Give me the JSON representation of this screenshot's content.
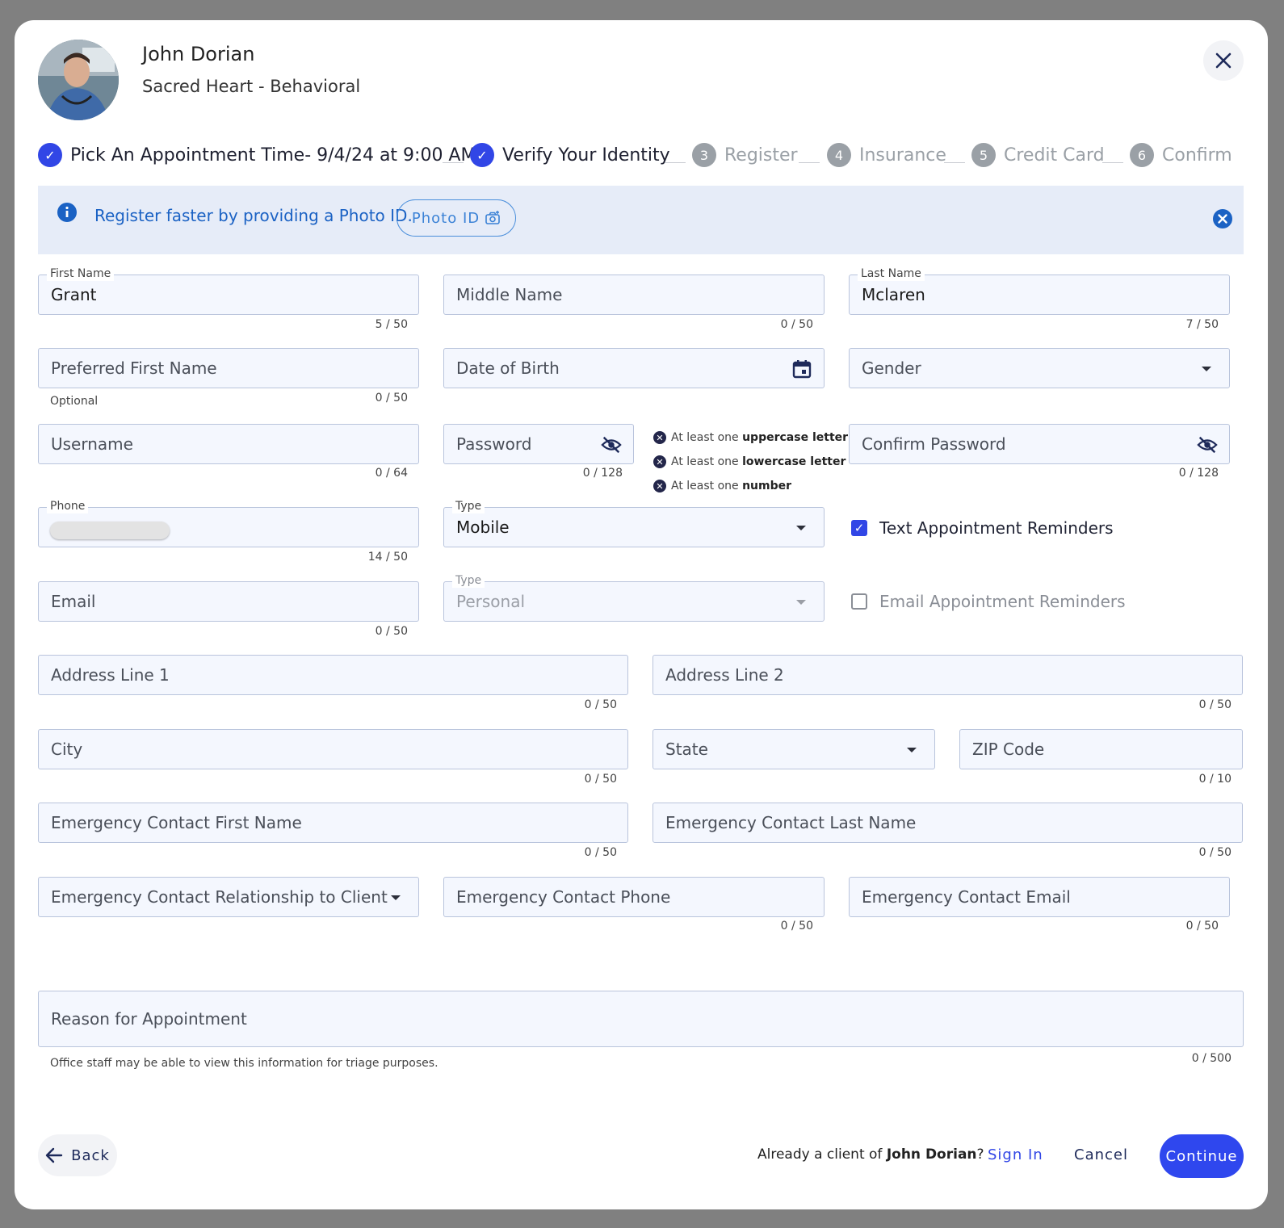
{
  "provider": {
    "name": "John Dorian",
    "organization": "Sacred Heart - Behavioral"
  },
  "stepper": [
    {
      "label": "Pick An Appointment Time- 9/4/24 at 9:00 AM",
      "state": "done",
      "num": ""
    },
    {
      "label": "Verify Your Identity",
      "state": "done",
      "num": ""
    },
    {
      "label": "Register",
      "state": "todo",
      "num": "3"
    },
    {
      "label": "Insurance",
      "state": "todo",
      "num": "4"
    },
    {
      "label": "Credit Card",
      "state": "todo",
      "num": "5"
    },
    {
      "label": "Confirm",
      "state": "todo",
      "num": "6"
    }
  ],
  "banner": {
    "text": "Register faster by providing a Photo ID.",
    "button": "Photo ID"
  },
  "fields": {
    "first_name": {
      "label": "First Name",
      "value": "Grant",
      "counter": "5 / 50"
    },
    "middle_name": {
      "placeholder": "Middle Name",
      "counter": "0 / 50"
    },
    "last_name": {
      "label": "Last Name",
      "value": "Mclaren",
      "counter": "7 / 50"
    },
    "preferred_first_name": {
      "placeholder": "Preferred First Name",
      "hint": "Optional",
      "counter": "0 / 50"
    },
    "date_of_birth": {
      "placeholder": "Date of Birth"
    },
    "gender": {
      "placeholder": "Gender"
    },
    "username": {
      "placeholder": "Username",
      "counter": "0 / 64"
    },
    "password": {
      "placeholder": "Password",
      "counter": "0 / 128"
    },
    "confirm_password": {
      "placeholder": "Confirm Password",
      "counter": "0 / 128"
    },
    "phone": {
      "label": "Phone",
      "counter": "14 / 50"
    },
    "phone_type": {
      "label": "Type",
      "value": "Mobile"
    },
    "email": {
      "placeholder": "Email",
      "counter": "0 / 50"
    },
    "email_type": {
      "label": "Type",
      "value": "Personal"
    },
    "address1": {
      "placeholder": "Address Line 1",
      "counter": "0 / 50"
    },
    "address2": {
      "placeholder": "Address Line 2",
      "counter": "0 / 50"
    },
    "city": {
      "placeholder": "City",
      "counter": "0 / 50"
    },
    "state": {
      "placeholder": "State"
    },
    "zip": {
      "placeholder": "ZIP Code",
      "counter": "0 / 10"
    },
    "ec_first": {
      "placeholder": "Emergency Contact First Name",
      "counter": "0 / 50"
    },
    "ec_last": {
      "placeholder": "Emergency Contact Last Name",
      "counter": "0 / 50"
    },
    "ec_relationship": {
      "placeholder": "Emergency Contact Relationship to Client"
    },
    "ec_phone": {
      "placeholder": "Emergency Contact Phone",
      "counter": "0 / 50"
    },
    "ec_email": {
      "placeholder": "Emergency Contact Email",
      "counter": "0 / 50"
    },
    "reason": {
      "placeholder": "Reason for Appointment",
      "hint": "Office staff may be able to view this information for triage purposes.",
      "counter": "0 / 500"
    }
  },
  "password_rules": [
    {
      "prefix": "At least one ",
      "bold": "uppercase letter"
    },
    {
      "prefix": "At least one ",
      "bold": "lowercase letter"
    },
    {
      "prefix": "At least one ",
      "bold": "number"
    }
  ],
  "checkboxes": {
    "text_reminders": {
      "label": "Text Appointment Reminders",
      "checked": true
    },
    "email_reminders": {
      "label": "Email Appointment Reminders",
      "checked": false
    }
  },
  "footer": {
    "back": "Back",
    "already_prefix": "Already a client of ",
    "already_name": "John Dorian",
    "already_suffix": "?",
    "sign_in": "Sign In",
    "cancel": "Cancel",
    "continue": "Continue"
  },
  "colors": {
    "accent": "#3146e6",
    "banner_bg": "#e6ecf8",
    "field_bg": "#f4f7fe"
  }
}
